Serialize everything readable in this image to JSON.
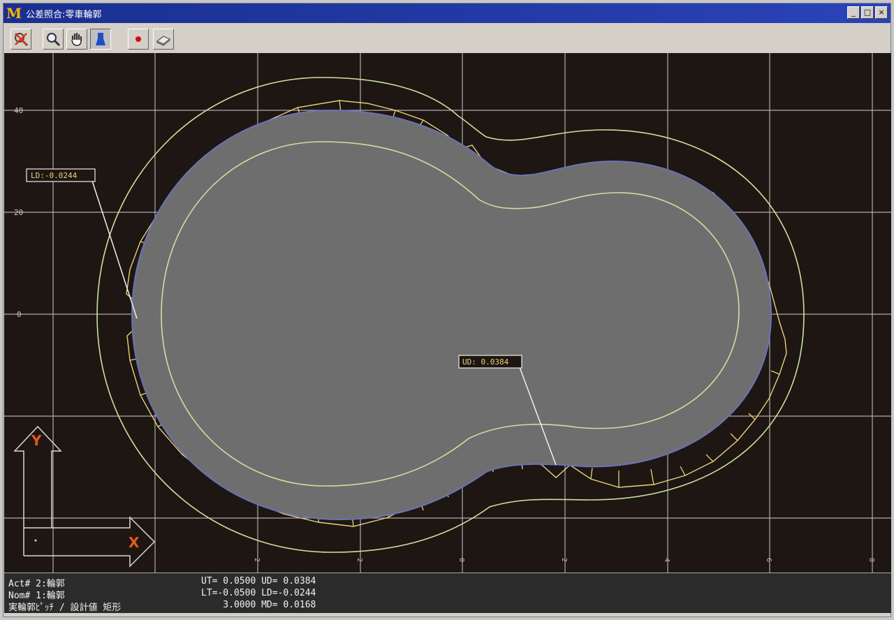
{
  "window": {
    "title": "公差照合:零車輪郭"
  },
  "toolbar": {
    "buttons": [
      {
        "name": "cancel-tool",
        "icon": "cross-magnifier-icon"
      },
      {
        "name": "zoom-tool",
        "icon": "magnifier-icon"
      },
      {
        "name": "pan-tool",
        "icon": "hand-icon"
      },
      {
        "name": "view-tool",
        "icon": "figure-icon"
      },
      {
        "name": "point-tool",
        "icon": "red-dot-icon"
      },
      {
        "name": "eraser-tool",
        "icon": "eraser-icon"
      }
    ]
  },
  "plot": {
    "y_ticks": [
      "40",
      "20",
      "0"
    ],
    "callouts": {
      "lower": "LD:-0.0244",
      "upper": "UD: 0.0384"
    },
    "axis_labels": {
      "y": "Y",
      "x": "X"
    },
    "colors": {
      "part": "#6e6e6e",
      "tolerance": "#c9e2a0",
      "deviation": "#e8d27a",
      "outline": "#6a72b8"
    }
  },
  "status": {
    "left": [
      "Act# 2:輪郭",
      "Nom# 1:輪郭",
      "実輪郭ﾋﾟｯﾁ / 設計値 矩形"
    ],
    "right": [
      "UT= 0.0500 UD= 0.0384",
      "LT=-0.0500 LD=-0.0244",
      "    3.0000 MD= 0.0168"
    ]
  }
}
